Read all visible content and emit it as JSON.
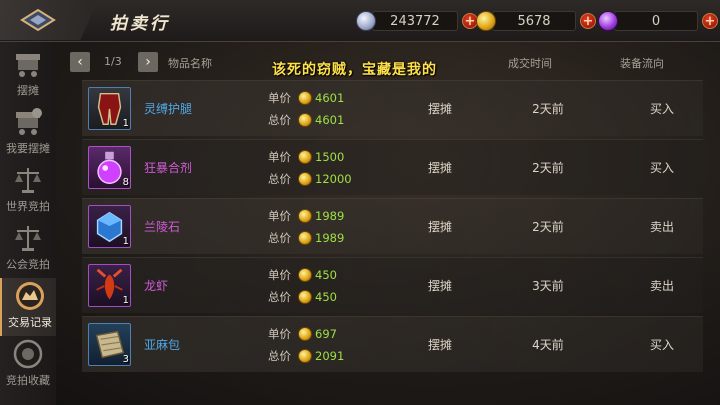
{
  "header": {
    "title": "拍卖行",
    "currencies": [
      {
        "icon": "silver-coin-icon",
        "value": "243772"
      },
      {
        "icon": "gold-coin-icon",
        "value": "5678"
      },
      {
        "icon": "purple-gem-icon",
        "value": "0"
      }
    ]
  },
  "sidebar": {
    "items": [
      {
        "label": "摆摊",
        "icon": "stall-cart-icon",
        "active": false
      },
      {
        "label": "我要摆摊",
        "icon": "my-stall-icon",
        "active": false
      },
      {
        "label": "世界竞拍",
        "icon": "world-scale-icon",
        "active": false
      },
      {
        "label": "公会竞拍",
        "icon": "guild-scale-icon",
        "active": false
      },
      {
        "label": "交易记录",
        "icon": "trade-record-icon",
        "active": true
      },
      {
        "label": "竞拍收藏",
        "icon": "auction-favorite-icon",
        "active": false
      }
    ]
  },
  "table": {
    "page": "1/3",
    "prev": "‹",
    "next": "›",
    "columns": {
      "name": "物品名称",
      "time": "成交时间",
      "flow": "装备流向"
    },
    "banner": "该死的窃贼，宝藏是我的",
    "unit_label": "单价",
    "total_label": "总价",
    "rows": [
      {
        "name": "灵缚护腿",
        "name_color": "#4fa8e8",
        "icon": "leg-armor-icon",
        "qty": "1",
        "unit": "4601",
        "total": "4601",
        "trade": "摆摊",
        "time": "2天前",
        "flow": "买入"
      },
      {
        "name": "狂暴合剂",
        "name_color": "#d05ad8",
        "icon": "potion-icon",
        "qty": "8",
        "unit": "1500",
        "total": "12000",
        "trade": "摆摊",
        "time": "2天前",
        "flow": "买入"
      },
      {
        "name": "兰陵石",
        "name_color": "#d05ad8",
        "icon": "blue-gem-icon",
        "qty": "1",
        "unit": "1989",
        "total": "1989",
        "trade": "摆摊",
        "time": "2天前",
        "flow": "卖出"
      },
      {
        "name": "龙虾",
        "name_color": "#d05ad8",
        "icon": "lobster-icon",
        "qty": "1",
        "unit": "450",
        "total": "450",
        "trade": "摆摊",
        "time": "3天前",
        "flow": "卖出"
      },
      {
        "name": "亚麻包",
        "name_color": "#4fa8e8",
        "icon": "linen-bag-icon",
        "qty": "3",
        "unit": "697",
        "total": "2091",
        "trade": "摆摊",
        "time": "4天前",
        "flow": "买入"
      }
    ]
  }
}
